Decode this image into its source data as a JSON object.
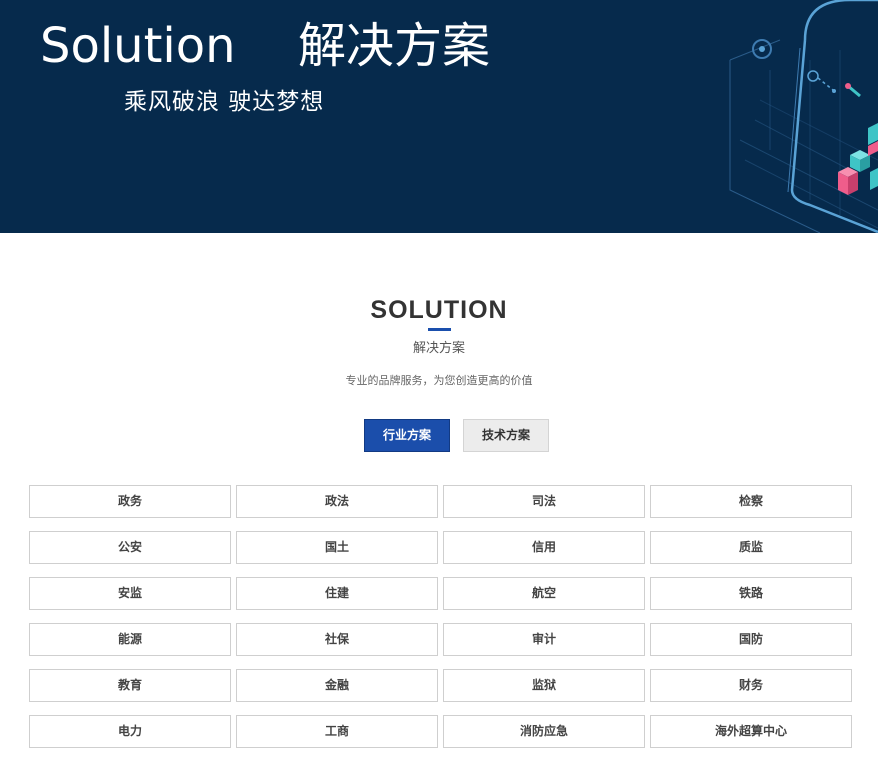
{
  "banner": {
    "title_en": "Solution",
    "title_zh": "解决方案",
    "subtitle": "乘风破浪  驶达梦想"
  },
  "section": {
    "heading": "SOLUTION",
    "subheading": "解决方案",
    "tagline": "专业的品牌服务，为您创造更高的价值"
  },
  "tabs": [
    {
      "label": "行业方案",
      "active": true
    },
    {
      "label": "技术方案",
      "active": false
    }
  ],
  "industries": [
    "政务",
    "政法",
    "司法",
    "检察",
    "公安",
    "国土",
    "信用",
    "质监",
    "安监",
    "住建",
    "航空",
    "铁路",
    "能源",
    "社保",
    "审计",
    "国防",
    "教育",
    "金融",
    "监狱",
    "财务",
    "电力",
    "工商",
    "消防应急",
    "海外超算中心"
  ],
  "colors": {
    "banner_bg": "#062a4c",
    "accent": "#1b4eab",
    "art_line": "#3e7bb0",
    "cube_teal": "#3fc4c6",
    "cube_pink": "#ef5d8b"
  }
}
